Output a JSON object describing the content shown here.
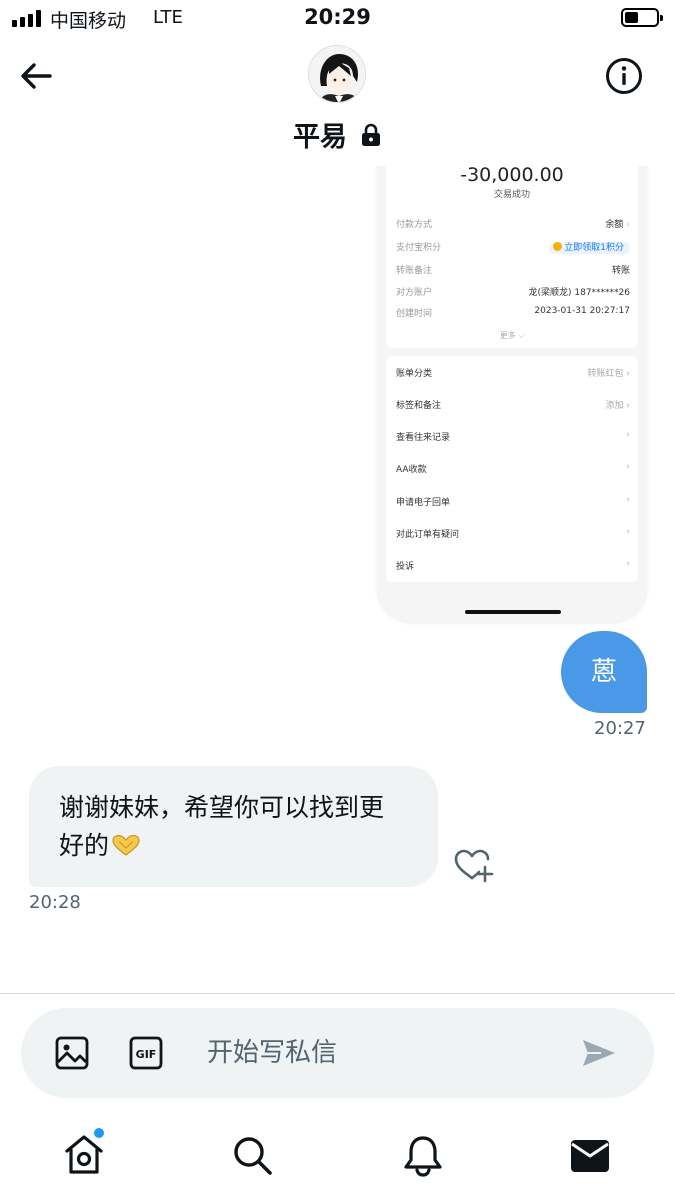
{
  "status_bar": {
    "carrier": "中国移动",
    "network": "LTE",
    "time": "20:29"
  },
  "header": {
    "title": "平易"
  },
  "receipt": {
    "amount": "-30,000.00",
    "status": "交易成功",
    "details": [
      {
        "label": "付款方式",
        "value": "余额"
      },
      {
        "label": "支付宝积分",
        "value": "立即领取1积分"
      },
      {
        "label": "转账备注",
        "value": "转账"
      },
      {
        "label": "对方账户",
        "value": "龙(梁顺龙) 187******26"
      },
      {
        "label": "创建时间",
        "value": "2023-01-31 20:27:17"
      }
    ],
    "more": "更多",
    "actions": [
      {
        "label": "账单分类",
        "value": "转账红包"
      },
      {
        "label": "标签和备注",
        "value": "添加"
      },
      {
        "label": "查看往来记录",
        "value": ""
      },
      {
        "label": "AA收款",
        "value": ""
      },
      {
        "label": "申请电子回单",
        "value": ""
      },
      {
        "label": "对此订单有疑问",
        "value": ""
      },
      {
        "label": "投诉",
        "value": ""
      }
    ]
  },
  "messages": {
    "outgoing": {
      "text": "蒽",
      "time": "20:27"
    },
    "incoming": {
      "line1": "谢谢妹妹，希望你可以找到更",
      "line2": "好的",
      "emoji": "heart-hands-emoji",
      "time": "20:28"
    }
  },
  "composer": {
    "placeholder": "开始写私信",
    "value": ""
  },
  "icons": {
    "back": "arrow-left-icon",
    "info": "info-icon",
    "lock": "lock-icon",
    "image": "image-icon",
    "gif": "gif-icon",
    "send": "send-icon",
    "home": "home-icon",
    "search": "search-icon",
    "notifications": "bell-icon",
    "messages": "envelope-icon",
    "like": "heart-plus-icon"
  },
  "colors": {
    "accent": "#1d9bf0",
    "outgoing_bubble": "#4a99e9",
    "incoming_bubble": "#eff3f4",
    "secondary_text": "#536471"
  }
}
